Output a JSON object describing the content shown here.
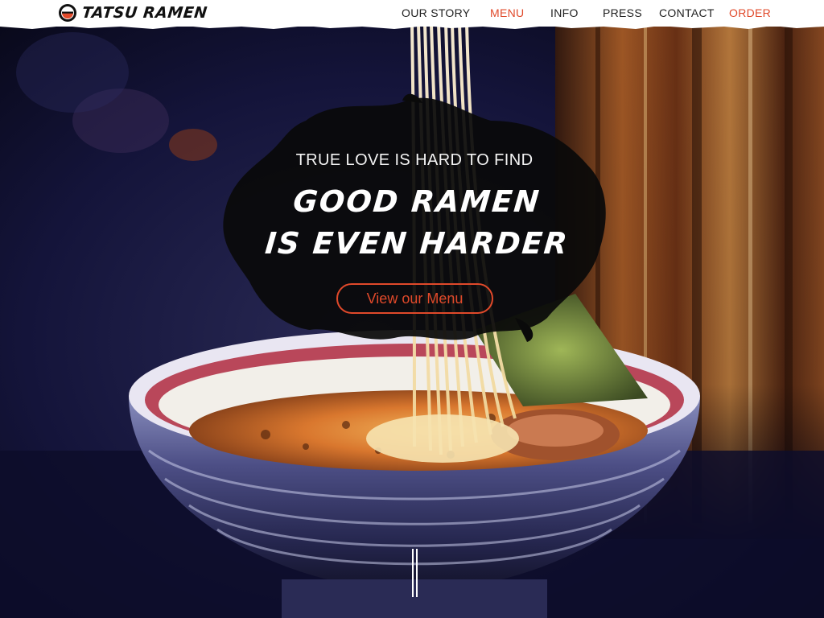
{
  "brand": {
    "name": "TATSU RAMEN",
    "accent_color": "#e0492a",
    "logo_icon": "ramen-bowl-icon"
  },
  "nav": {
    "items": [
      {
        "label": "OUR STORY",
        "active": false
      },
      {
        "label": "MENU",
        "active": true
      },
      {
        "label": "INFO",
        "active": false
      },
      {
        "label": "PRESS",
        "active": false
      },
      {
        "label": "CONTACT",
        "active": false
      },
      {
        "label": "ORDER",
        "active": false,
        "highlight": true
      }
    ]
  },
  "hero": {
    "tagline": "TRUE LOVE IS HARD TO FIND",
    "headline_line1": "GOOD RAMEN",
    "headline_line2": "IS EVEN HARDER",
    "cta_label": "View our Menu",
    "scroll_icon": "scroll-down-icon"
  }
}
